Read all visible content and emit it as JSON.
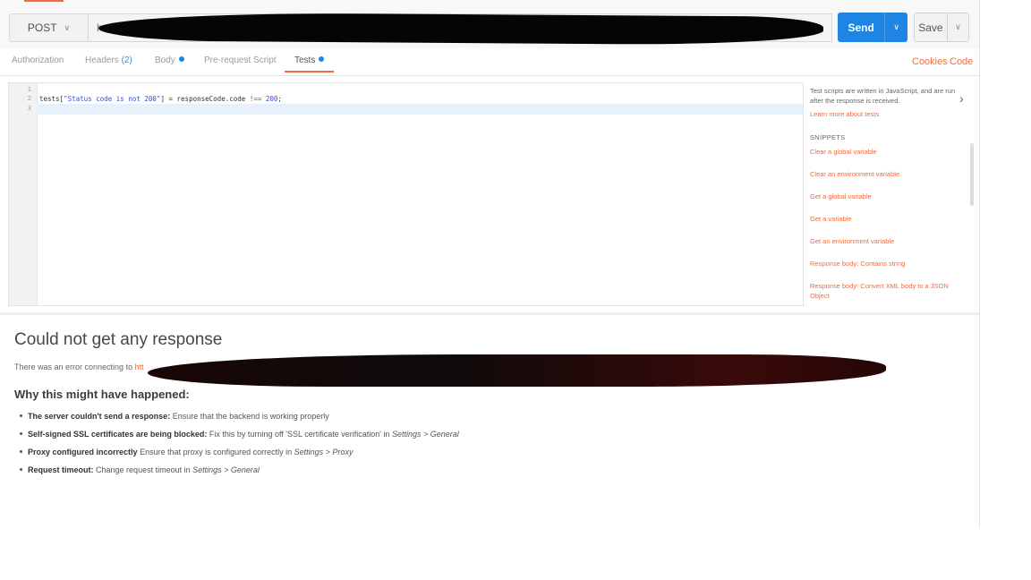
{
  "request": {
    "method": "POST",
    "url_prefix": "h",
    "send_label": "Send",
    "save_label": "Save"
  },
  "tabs": [
    {
      "label": "Authorization"
    },
    {
      "label": "Headers",
      "count": "(2)"
    },
    {
      "label": "Body",
      "dot": true
    },
    {
      "label": "Pre-request Script"
    },
    {
      "label": "Tests",
      "dot": true,
      "active": true
    }
  ],
  "tab_links": {
    "cookies": "Cookies",
    "code": "Code"
  },
  "editor": {
    "line_numbers": [
      "1",
      "2",
      "3"
    ],
    "code_prefix": "tests[",
    "code_string": "\"Status code is not 200\"",
    "code_mid": "] = responseCode.code ",
    "code_op": "!==",
    "code_num": "200",
    "code_end": ";"
  },
  "sidebar": {
    "description": "Test scripts are written in JavaScript, and are run after the response is received.",
    "learn_more": "Learn more about tests",
    "snippets_heading": "SNIPPETS",
    "snippets": [
      "Clear a global variable",
      "Clear an environment variable",
      "Get a global variable",
      "Get a variable",
      "Get an environment variable",
      "Response body: Contains string",
      "Response body: Convert XML body to a JSON Object"
    ]
  },
  "response": {
    "title": "Could not get any response",
    "error_text": "There was an error connecting to ",
    "error_link": "htt",
    "why_heading": "Why this might have happened:",
    "reasons": [
      {
        "bold": "The server couldn't send a response:",
        "text": "Ensure that the backend is working properly",
        "italic": ""
      },
      {
        "bold": "Self-signed SSL certificates are being blocked:",
        "text": "Fix this by turning off 'SSL certificate verification' in",
        "italic": "Settings > General"
      },
      {
        "bold": "Proxy configured incorrectly",
        "text": "Ensure that proxy is configured correctly in",
        "italic": "Settings > Proxy"
      },
      {
        "bold": "Request timeout:",
        "text": "Change request timeout in",
        "italic": "Settings > General"
      }
    ]
  },
  "colors": {
    "accent_orange": "#f26b3a",
    "send_blue": "#1f85e5"
  },
  "icons": {
    "method_dropdown": "chevron-down-icon",
    "send_dropdown": "chevron-down-icon",
    "save_dropdown": "chevron-down-icon",
    "sidebar_toggle": "chevron-right-icon"
  }
}
